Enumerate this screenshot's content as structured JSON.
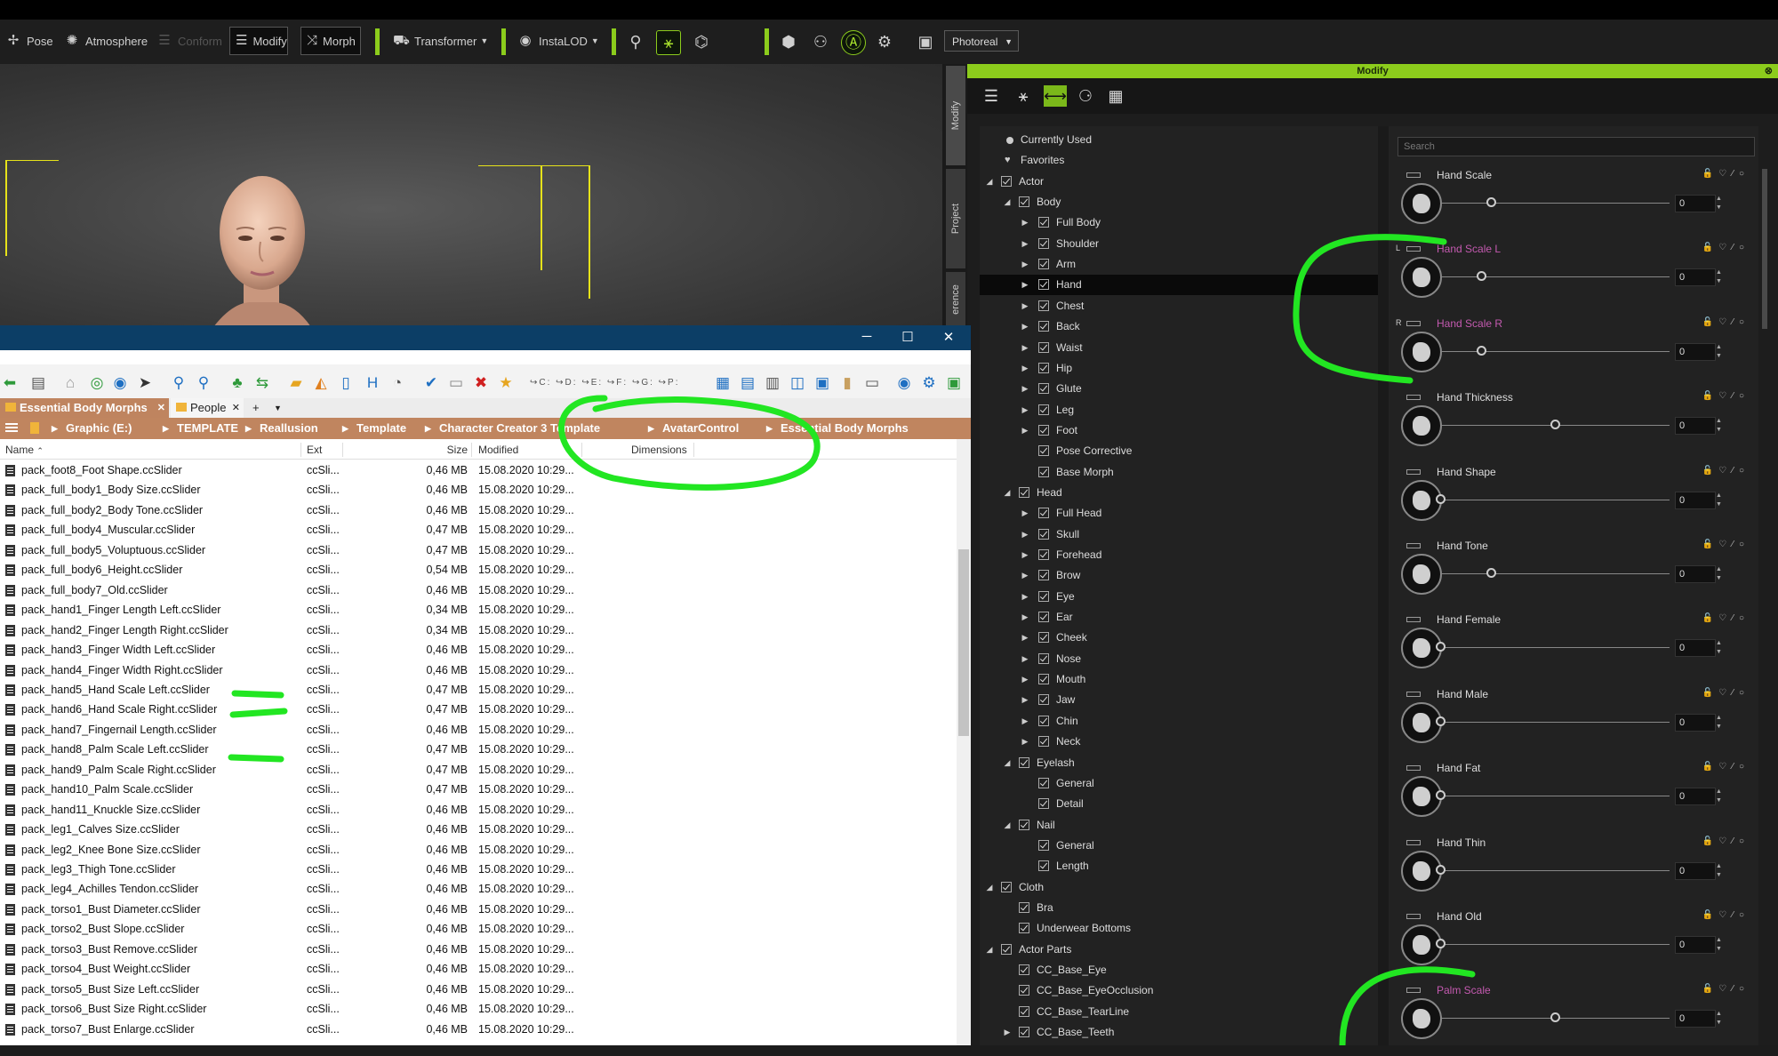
{
  "toolbar": {
    "pose": "Pose",
    "atmosphere": "Atmosphere",
    "conform": "Conform",
    "modify": "Modify",
    "morph": "Morph",
    "transformer": "Transformer",
    "instalod": "InstaLOD",
    "render_mode": "Photoreal"
  },
  "side_tabs": {
    "modify": "Modify",
    "project": "Project",
    "reference": "erence"
  },
  "explorer": {
    "tabs": [
      "Essential Body Morphs",
      "People"
    ],
    "path": [
      "Graphic (E:)",
      "TEMPLATE",
      "Reallusion",
      "Template",
      "Character Creator 3 Template",
      "AvatarControl",
      "Essential Body Morphs"
    ],
    "columns": {
      "name": "Name",
      "ext": "Ext",
      "size": "Size",
      "modified": "Modified",
      "dimensions": "Dimensions"
    },
    "files": [
      {
        "name": "pack_foot8_Foot Shape.ccSlider",
        "ext": "ccSli...",
        "size": "0,46 MB",
        "modified": "15.08.2020 10:29..."
      },
      {
        "name": "pack_full_body1_Body Size.ccSlider",
        "ext": "ccSli...",
        "size": "0,46 MB",
        "modified": "15.08.2020 10:29..."
      },
      {
        "name": "pack_full_body2_Body Tone.ccSlider",
        "ext": "ccSli...",
        "size": "0,46 MB",
        "modified": "15.08.2020 10:29..."
      },
      {
        "name": "pack_full_body4_Muscular.ccSlider",
        "ext": "ccSli...",
        "size": "0,47 MB",
        "modified": "15.08.2020 10:29..."
      },
      {
        "name": "pack_full_body5_Voluptuous.ccSlider",
        "ext": "ccSli...",
        "size": "0,47 MB",
        "modified": "15.08.2020 10:29..."
      },
      {
        "name": "pack_full_body6_Height.ccSlider",
        "ext": "ccSli...",
        "size": "0,54 MB",
        "modified": "15.08.2020 10:29..."
      },
      {
        "name": "pack_full_body7_Old.ccSlider",
        "ext": "ccSli...",
        "size": "0,46 MB",
        "modified": "15.08.2020 10:29..."
      },
      {
        "name": "pack_hand1_Finger Length Left.ccSlider",
        "ext": "ccSli...",
        "size": "0,34 MB",
        "modified": "15.08.2020 10:29..."
      },
      {
        "name": "pack_hand2_Finger Length Right.ccSlider",
        "ext": "ccSli...",
        "size": "0,34 MB",
        "modified": "15.08.2020 10:29..."
      },
      {
        "name": "pack_hand3_Finger Width Left.ccSlider",
        "ext": "ccSli...",
        "size": "0,46 MB",
        "modified": "15.08.2020 10:29..."
      },
      {
        "name": "pack_hand4_Finger Width Right.ccSlider",
        "ext": "ccSli...",
        "size": "0,46 MB",
        "modified": "15.08.2020 10:29..."
      },
      {
        "name": "pack_hand5_Hand Scale Left.ccSlider",
        "ext": "ccSli...",
        "size": "0,47 MB",
        "modified": "15.08.2020 10:29..."
      },
      {
        "name": "pack_hand6_Hand Scale Right.ccSlider",
        "ext": "ccSli...",
        "size": "0,47 MB",
        "modified": "15.08.2020 10:29..."
      },
      {
        "name": "pack_hand7_Fingernail Length.ccSlider",
        "ext": "ccSli...",
        "size": "0,46 MB",
        "modified": "15.08.2020 10:29..."
      },
      {
        "name": "pack_hand8_Palm Scale Left.ccSlider",
        "ext": "ccSli...",
        "size": "0,47 MB",
        "modified": "15.08.2020 10:29..."
      },
      {
        "name": "pack_hand9_Palm Scale Right.ccSlider",
        "ext": "ccSli...",
        "size": "0,47 MB",
        "modified": "15.08.2020 10:29..."
      },
      {
        "name": "pack_hand10_Palm Scale.ccSlider",
        "ext": "ccSli...",
        "size": "0,47 MB",
        "modified": "15.08.2020 10:29..."
      },
      {
        "name": "pack_hand11_Knuckle Size.ccSlider",
        "ext": "ccSli...",
        "size": "0,46 MB",
        "modified": "15.08.2020 10:29..."
      },
      {
        "name": "pack_leg1_Calves Size.ccSlider",
        "ext": "ccSli...",
        "size": "0,46 MB",
        "modified": "15.08.2020 10:29..."
      },
      {
        "name": "pack_leg2_Knee Bone Size.ccSlider",
        "ext": "ccSli...",
        "size": "0,46 MB",
        "modified": "15.08.2020 10:29..."
      },
      {
        "name": "pack_leg3_Thigh Tone.ccSlider",
        "ext": "ccSli...",
        "size": "0,46 MB",
        "modified": "15.08.2020 10:29..."
      },
      {
        "name": "pack_leg4_Achilles Tendon.ccSlider",
        "ext": "ccSli...",
        "size": "0,46 MB",
        "modified": "15.08.2020 10:29..."
      },
      {
        "name": "pack_torso1_Bust Diameter.ccSlider",
        "ext": "ccSli...",
        "size": "0,46 MB",
        "modified": "15.08.2020 10:29..."
      },
      {
        "name": "pack_torso2_Bust Slope.ccSlider",
        "ext": "ccSli...",
        "size": "0,46 MB",
        "modified": "15.08.2020 10:29..."
      },
      {
        "name": "pack_torso3_Bust Remove.ccSlider",
        "ext": "ccSli...",
        "size": "0,46 MB",
        "modified": "15.08.2020 10:29..."
      },
      {
        "name": "pack_torso4_Bust Weight.ccSlider",
        "ext": "ccSli...",
        "size": "0,46 MB",
        "modified": "15.08.2020 10:29..."
      },
      {
        "name": "pack_torso5_Bust Size Left.ccSlider",
        "ext": "ccSli...",
        "size": "0,46 MB",
        "modified": "15.08.2020 10:29..."
      },
      {
        "name": "pack_torso6_Bust Size Right.ccSlider",
        "ext": "ccSli...",
        "size": "0,46 MB",
        "modified": "15.08.2020 10:29..."
      },
      {
        "name": "pack_torso7_Bust Enlarge.ccSlider",
        "ext": "ccSli...",
        "size": "0,46 MB",
        "modified": "15.08.2020 10:29..."
      }
    ]
  },
  "modify_panel": {
    "title": "Modify",
    "search_placeholder": "Search",
    "tree": [
      {
        "label": "Currently Used",
        "level": 0,
        "kind": "dot"
      },
      {
        "label": "Favorites",
        "level": 0,
        "kind": "heart"
      },
      {
        "label": "Actor",
        "level": 0,
        "kind": "check",
        "arrow": "open"
      },
      {
        "label": "Body",
        "level": 1,
        "kind": "check",
        "arrow": "open"
      },
      {
        "label": "Full Body",
        "level": 2,
        "kind": "check",
        "arrow": "closed"
      },
      {
        "label": "Shoulder",
        "level": 2,
        "kind": "check",
        "arrow": "closed"
      },
      {
        "label": "Arm",
        "level": 2,
        "kind": "check",
        "arrow": "closed"
      },
      {
        "label": "Hand",
        "level": 2,
        "kind": "check",
        "arrow": "closed",
        "selected": true
      },
      {
        "label": "Chest",
        "level": 2,
        "kind": "check",
        "arrow": "closed"
      },
      {
        "label": "Back",
        "level": 2,
        "kind": "check",
        "arrow": "closed"
      },
      {
        "label": "Waist",
        "level": 2,
        "kind": "check",
        "arrow": "closed"
      },
      {
        "label": "Hip",
        "level": 2,
        "kind": "check",
        "arrow": "closed"
      },
      {
        "label": "Glute",
        "level": 2,
        "kind": "check",
        "arrow": "closed"
      },
      {
        "label": "Leg",
        "level": 2,
        "kind": "check",
        "arrow": "closed"
      },
      {
        "label": "Foot",
        "level": 2,
        "kind": "check",
        "arrow": "closed"
      },
      {
        "label": "Pose Corrective",
        "level": 2,
        "kind": "check"
      },
      {
        "label": "Base Morph",
        "level": 2,
        "kind": "check"
      },
      {
        "label": "Head",
        "level": 1,
        "kind": "check",
        "arrow": "open"
      },
      {
        "label": "Full Head",
        "level": 2,
        "kind": "check",
        "arrow": "closed"
      },
      {
        "label": "Skull",
        "level": 2,
        "kind": "check",
        "arrow": "closed"
      },
      {
        "label": "Forehead",
        "level": 2,
        "kind": "check",
        "arrow": "closed"
      },
      {
        "label": "Brow",
        "level": 2,
        "kind": "check",
        "arrow": "closed"
      },
      {
        "label": "Eye",
        "level": 2,
        "kind": "check",
        "arrow": "closed"
      },
      {
        "label": "Ear",
        "level": 2,
        "kind": "check",
        "arrow": "closed"
      },
      {
        "label": "Cheek",
        "level": 2,
        "kind": "check",
        "arrow": "closed"
      },
      {
        "label": "Nose",
        "level": 2,
        "kind": "check",
        "arrow": "closed"
      },
      {
        "label": "Mouth",
        "level": 2,
        "kind": "check",
        "arrow": "closed"
      },
      {
        "label": "Jaw",
        "level": 2,
        "kind": "check",
        "arrow": "closed"
      },
      {
        "label": "Chin",
        "level": 2,
        "kind": "check",
        "arrow": "closed"
      },
      {
        "label": "Neck",
        "level": 2,
        "kind": "check",
        "arrow": "closed"
      },
      {
        "label": "Eyelash",
        "level": 1,
        "kind": "check",
        "arrow": "open"
      },
      {
        "label": "General",
        "level": 2,
        "kind": "check"
      },
      {
        "label": "Detail",
        "level": 2,
        "kind": "check"
      },
      {
        "label": "Nail",
        "level": 1,
        "kind": "check",
        "arrow": "open"
      },
      {
        "label": "General",
        "level": 2,
        "kind": "check"
      },
      {
        "label": "Length",
        "level": 2,
        "kind": "check"
      },
      {
        "label": "Cloth",
        "level": 0,
        "kind": "check",
        "arrow": "open"
      },
      {
        "label": "Bra",
        "level": 1,
        "kind": "check"
      },
      {
        "label": "Underwear Bottoms",
        "level": 1,
        "kind": "check"
      },
      {
        "label": "Actor Parts",
        "level": 0,
        "kind": "check",
        "arrow": "open"
      },
      {
        "label": "CC_Base_Eye",
        "level": 1,
        "kind": "check"
      },
      {
        "label": "CC_Base_EyeOcclusion",
        "level": 1,
        "kind": "check"
      },
      {
        "label": "CC_Base_TearLine",
        "level": 1,
        "kind": "check"
      },
      {
        "label": "CC_Base_Teeth",
        "level": 1,
        "kind": "check",
        "arrow": "closed"
      }
    ],
    "sliders": [
      {
        "name": "Hand Scale",
        "value": "0",
        "pos": 0.22,
        "pink": false,
        "side": ""
      },
      {
        "name": "Hand Scale L",
        "value": "0",
        "pos": 0.18,
        "pink": true,
        "side": "L"
      },
      {
        "name": "Hand Scale R",
        "value": "0",
        "pos": 0.18,
        "pink": true,
        "side": "R"
      },
      {
        "name": "Hand Thickness",
        "value": "0",
        "pos": 0.5,
        "pink": false,
        "side": ""
      },
      {
        "name": "Hand Shape",
        "value": "0",
        "pos": 0.0,
        "pink": false,
        "side": ""
      },
      {
        "name": "Hand Tone",
        "value": "0",
        "pos": 0.22,
        "pink": false,
        "side": ""
      },
      {
        "name": "Hand Female",
        "value": "0",
        "pos": 0.0,
        "pink": false,
        "side": ""
      },
      {
        "name": "Hand Male",
        "value": "0",
        "pos": 0.0,
        "pink": false,
        "side": ""
      },
      {
        "name": "Hand Fat",
        "value": "0",
        "pos": 0.0,
        "pink": false,
        "side": ""
      },
      {
        "name": "Hand Thin",
        "value": "0",
        "pos": 0.0,
        "pink": false,
        "side": ""
      },
      {
        "name": "Hand Old",
        "value": "0",
        "pos": 0.0,
        "pink": false,
        "side": ""
      },
      {
        "name": "Palm Scale",
        "value": "0",
        "pos": 0.5,
        "pink": true,
        "side": ""
      }
    ]
  },
  "colors": {
    "accent": "#8ccc1c",
    "annotation": "#22e622",
    "path_bar": "#c0855f",
    "pink_label": "#c45ab0"
  }
}
